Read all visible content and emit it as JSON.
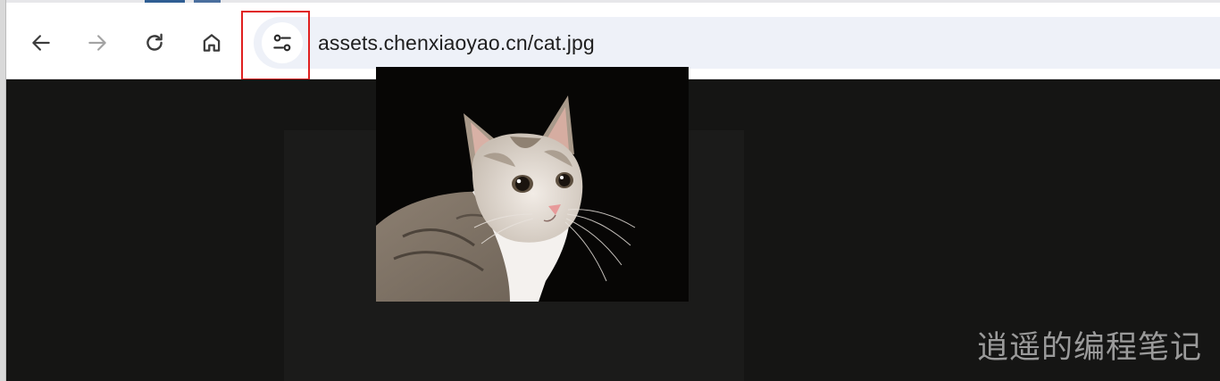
{
  "browser": {
    "nav": {
      "back_icon": "arrow-left-icon",
      "forward_icon": "arrow-right-icon",
      "reload_icon": "reload-icon",
      "home_icon": "home-icon"
    },
    "omnibox": {
      "site_info_icon": "tune-icon",
      "url": "assets.chenxiaoyao.cn/cat.jpg"
    },
    "highlight_color": "#e02020"
  },
  "page": {
    "image_subject": "cat",
    "background_color": "#151514"
  },
  "watermark": {
    "text": "逍遥的编程笔记"
  }
}
